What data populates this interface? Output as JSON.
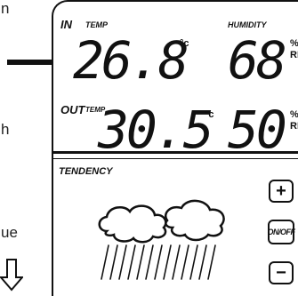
{
  "left_text": {
    "line1": "n",
    "line2": "h",
    "line3": "ue"
  },
  "indoor": {
    "label": "IN",
    "temp_label": "TEMP",
    "temperature": "26.8",
    "temp_unit": "°c",
    "humidity_label": "HUMIDITY",
    "humidity": "68",
    "humidity_unit_pct": "%",
    "humidity_unit_rh": "RH"
  },
  "outdoor": {
    "label": "OUT",
    "temp_label": "TEMP",
    "temperature": "30.5",
    "temp_unit": "°c",
    "humidity": "50",
    "humidity_unit_pct": "%",
    "humidity_unit_rh": "RH"
  },
  "tendency": {
    "label": "TENDENCY",
    "icon": "rain-cloud-icon",
    "trend_icon": "down-arrow-icon"
  },
  "buttons": {
    "plus": "+",
    "onoff": "ON/OFF",
    "minus": "−"
  },
  "colors": {
    "ink": "#111111",
    "background": "#ffffff"
  }
}
